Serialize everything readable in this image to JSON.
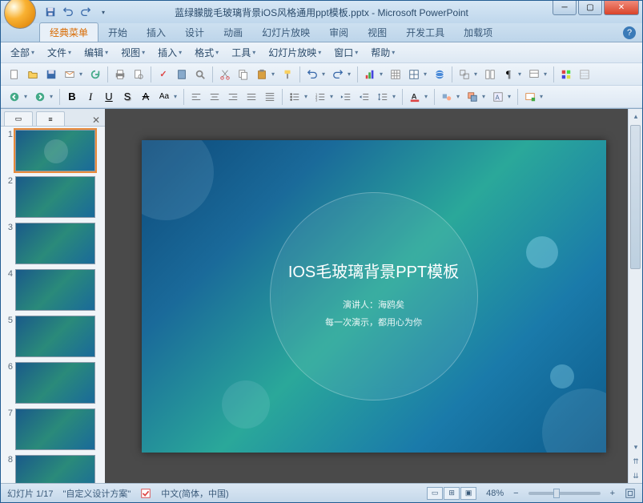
{
  "title": "蓝绿朦胧毛玻璃背景iOS风格通用ppt模板.pptx - Microsoft PowerPoint",
  "ribbon": {
    "tabs": [
      "经典菜单",
      "开始",
      "插入",
      "设计",
      "动画",
      "幻灯片放映",
      "审阅",
      "视图",
      "开发工具",
      "加载项"
    ],
    "active": 0
  },
  "menu": {
    "items": [
      "全部",
      "文件",
      "编辑",
      "视图",
      "插入",
      "格式",
      "工具",
      "幻灯片放映",
      "窗口",
      "帮助"
    ]
  },
  "slide": {
    "title": "IOS毛玻璃背景PPT模板",
    "presenter": "演讲人：海鸥矣",
    "motto": "每一次演示，都用心为你"
  },
  "thumbs": {
    "count": 8,
    "active": 1
  },
  "status": {
    "slide_counter": "幻灯片 1/17",
    "theme": "\"自定义设计方案\"",
    "lang": "中文(简体，中国)",
    "zoom": "48%"
  }
}
